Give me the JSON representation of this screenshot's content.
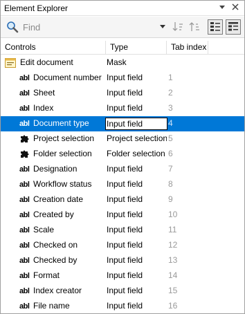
{
  "panel": {
    "title": "Element Explorer",
    "pin_glyph": "▾ ✕"
  },
  "search": {
    "placeholder": "Find"
  },
  "columns": {
    "controls": "Controls",
    "type": "Type",
    "tab_index": "Tab index"
  },
  "root": {
    "name": "Edit document",
    "type": "Mask",
    "icon": "form-icon"
  },
  "rows": [
    {
      "name": "Document number",
      "type": "Input field",
      "tab": "1",
      "icon": "text-field-icon"
    },
    {
      "name": "Sheet",
      "type": "Input field",
      "tab": "2",
      "icon": "text-field-icon"
    },
    {
      "name": "Index",
      "type": "Input field",
      "tab": "3",
      "icon": "text-field-icon"
    },
    {
      "name": "Document type",
      "type": "Input field",
      "tab": "4",
      "icon": "text-field-icon",
      "selected": true
    },
    {
      "name": "Project selection",
      "type": "Project selection",
      "tab": "5",
      "icon": "puzzle-icon"
    },
    {
      "name": "Folder selection",
      "type": "Folder selection",
      "tab": "6",
      "icon": "puzzle-icon"
    },
    {
      "name": "Designation",
      "type": "Input field",
      "tab": "7",
      "icon": "text-field-icon"
    },
    {
      "name": "Workflow status",
      "type": "Input field",
      "tab": "8",
      "icon": "text-field-icon"
    },
    {
      "name": "Creation date",
      "type": "Input field",
      "tab": "9",
      "icon": "text-field-icon"
    },
    {
      "name": "Created by",
      "type": "Input field",
      "tab": "10",
      "icon": "text-field-icon"
    },
    {
      "name": "Scale",
      "type": "Input field",
      "tab": "11",
      "icon": "text-field-icon"
    },
    {
      "name": "Checked on",
      "type": "Input field",
      "tab": "12",
      "icon": "text-field-icon"
    },
    {
      "name": "Checked by",
      "type": "Input field",
      "tab": "13",
      "icon": "text-field-icon"
    },
    {
      "name": "Format",
      "type": "Input field",
      "tab": "14",
      "icon": "text-field-icon"
    },
    {
      "name": "Index creator",
      "type": "Input field",
      "tab": "15",
      "icon": "text-field-icon"
    },
    {
      "name": "File name",
      "type": "Input field",
      "tab": "16",
      "icon": "text-field-icon"
    }
  ],
  "text_icon_label": "abl",
  "colors": {
    "selection": "#0078d7",
    "tab_index_text": "#9a9a9a"
  }
}
